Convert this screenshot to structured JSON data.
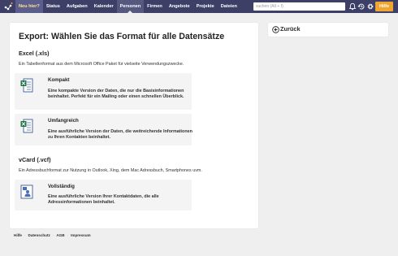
{
  "nav": {
    "items": [
      {
        "label": "Neu hier?",
        "state": "new"
      },
      {
        "label": "Status",
        "state": ""
      },
      {
        "label": "Aufgaben",
        "state": ""
      },
      {
        "label": "Kalender",
        "state": ""
      },
      {
        "label": "Personen",
        "state": "active"
      },
      {
        "label": "Firmen",
        "state": ""
      },
      {
        "label": "Angebote",
        "state": ""
      },
      {
        "label": "Projekte",
        "state": ""
      },
      {
        "label": "Dateien",
        "state": ""
      }
    ],
    "search_placeholder": "suchen (Alt + f)",
    "help_label": "Hilfe",
    "icons": [
      "bell-icon",
      "history-icon",
      "gear-icon"
    ]
  },
  "main": {
    "title": "Export: Wählen Sie das Format für alle Datensätze",
    "excel": {
      "title": "Excel (.xls)",
      "description": "Ein Tabellenformat aus dem Microsoft Office Paket für vielseite Verwendungszwecke.",
      "options": [
        {
          "title": "Kompakt",
          "description": "Eine kompakte Version der Daten, die nur die Basisinformationen beinhaltet. Perfekt für ein Mailing oder einen schnellen Überblick.",
          "icon": "excel-file-icon"
        },
        {
          "title": "Umfangreich",
          "description": "Eine ausführliche Version der Daten, die weitreichende Informationen zu Ihren Kontakten beinhaltet.",
          "icon": "excel-file-icon"
        }
      ]
    },
    "vcard": {
      "title": "vCard (.vcf)",
      "description": "Ein Adressbuchformat zur Nutzung in Outlook, Xing, dem Mac Adressbuch, Smartphones uvm.",
      "options": [
        {
          "title": "Vollständig",
          "description": "Eine ausführliche Version Ihrer Kontaktdaten, die alle Adressinformationen beinhaltet.",
          "icon": "vcard-file-icon"
        }
      ]
    }
  },
  "sidebar": {
    "back_label": "Zurück",
    "back_icon": "arrow-left-circle-icon"
  },
  "footer": {
    "links": [
      "Hilfe",
      "Datenschutz",
      "AGB",
      "Impressum"
    ]
  },
  "colors": {
    "nav_bg": "#3d3f66",
    "help_button": "#f0a431",
    "page_bg": "#efefef",
    "option_bg": "#f4f4f4",
    "excel_green": "#1e7145",
    "vcard_blue": "#4a6fb5"
  }
}
